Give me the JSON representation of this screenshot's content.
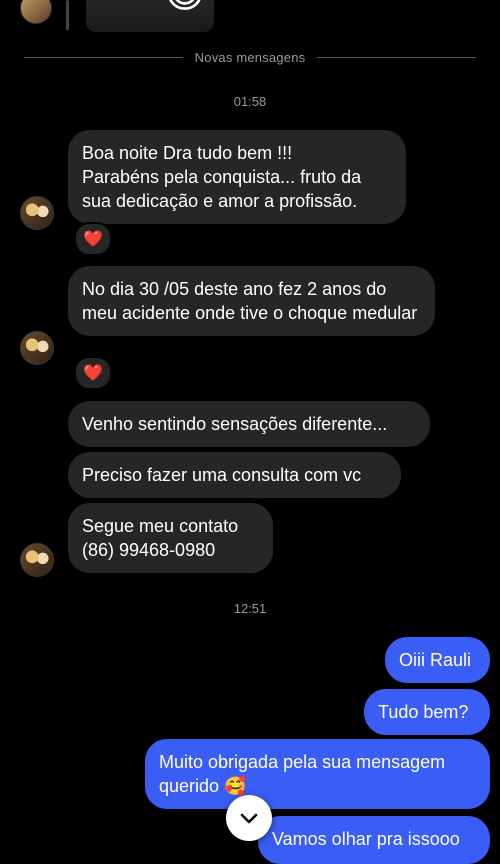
{
  "top": {
    "thumb_caption": "",
    "thumb_emoji": "😄"
  },
  "divider": {
    "label": "Novas mensagens"
  },
  "times": {
    "t1": "01:58",
    "t2": "12:51"
  },
  "incoming": [
    {
      "text": "Boa noite Dra tudo bem !!!\nParabéns pela conquista... fruto da sua dedicação e amor a profissão.",
      "reaction": "❤️"
    },
    {
      "text": "No dia 30 /05 deste ano fez 2 anos do meu acidente onde tive o choque medular",
      "reaction": "❤️"
    },
    {
      "text": "Venho sentindo sensações diferente..."
    },
    {
      "text": "Preciso fazer uma consulta com vc"
    },
    {
      "text": "Segue meu contato\n(86) 99468-0980"
    }
  ],
  "outgoing": [
    {
      "text": "Oiii Rauli"
    },
    {
      "text": "Tudo bem?"
    },
    {
      "text": "Muito obrigada pela sua mensagem querido 🥰"
    },
    {
      "text": "Vamos olhar pra issooo"
    }
  ],
  "icons": {
    "scroll_down": "chevron-down-icon"
  },
  "colors": {
    "incoming_bubble": "#262626",
    "outgoing_bubble": "#3a5df6",
    "background": "#000000"
  }
}
